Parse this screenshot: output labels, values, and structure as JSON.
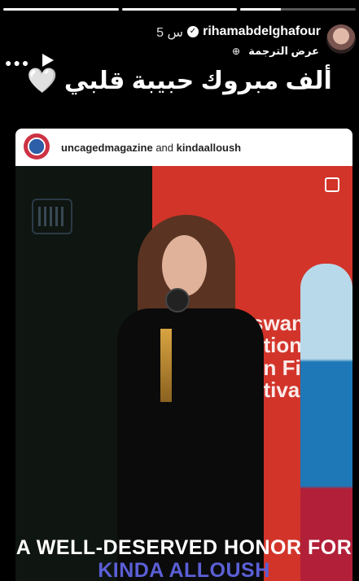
{
  "progress": {
    "segments": [
      1,
      1,
      0.35
    ]
  },
  "header": {
    "username": "rihamabdelghafour",
    "time": "5 س",
    "translate": "عرض الترجمة",
    "verified_glyph": "✓",
    "dots": "●●●",
    "globe": "⊕"
  },
  "caption": "ألف مبروك حبيبة قلبي 🤍",
  "card": {
    "account": "uncagedmagazine",
    "and": "and",
    "collab": "kindaalloush",
    "poster_text": "swan\national\nen Film\nstival",
    "overlay_line1": "A WELL-DESERVED HONOR FOR",
    "overlay_line2": "KINDA ALLOUSH"
  },
  "colors": {
    "accent": "#5b5fd6",
    "poster_red": "#d2342a"
  }
}
